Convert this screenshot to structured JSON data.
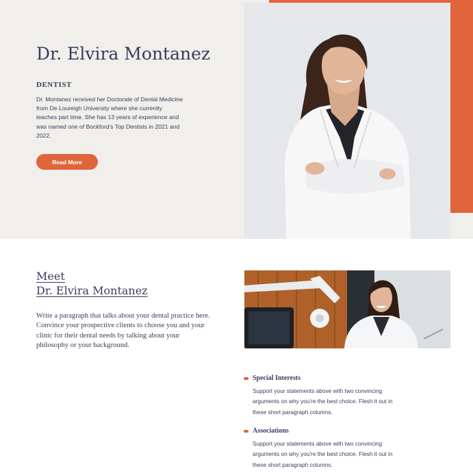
{
  "hero": {
    "name": "Dr. Elvira Montanez",
    "role": "DENTIST",
    "bio": "Dr. Montanez received her Doctorate of Dental Medicine from De Loureigh University where she currently teaches part time. She has 13 years of experience and was named one of Bockford's Top Dentists in 2021 and 2022.",
    "button_label": "Read More"
  },
  "meet": {
    "title_line1": "Meet",
    "title_line2": "Dr. Elvira Montanez",
    "paragraph": "Write a paragraph that talks about your dental practice here. Convince your prospective clients to choose you and your clinic for their dental needs by talking about your philosophy or your background."
  },
  "features": [
    {
      "title": "Special Interests",
      "text": "Support your statements above with two convincing arguments on why you're the best choice. Flesh it out in these short paragraph columns."
    },
    {
      "title": "Associations",
      "text": "Support your statements above with two convincing arguments on why you're the best choice. Flesh it out in these short paragraph columns."
    }
  ],
  "colors": {
    "accent": "#e0653a",
    "text": "#3b3a5e",
    "hero_background": "#f1efeb"
  }
}
